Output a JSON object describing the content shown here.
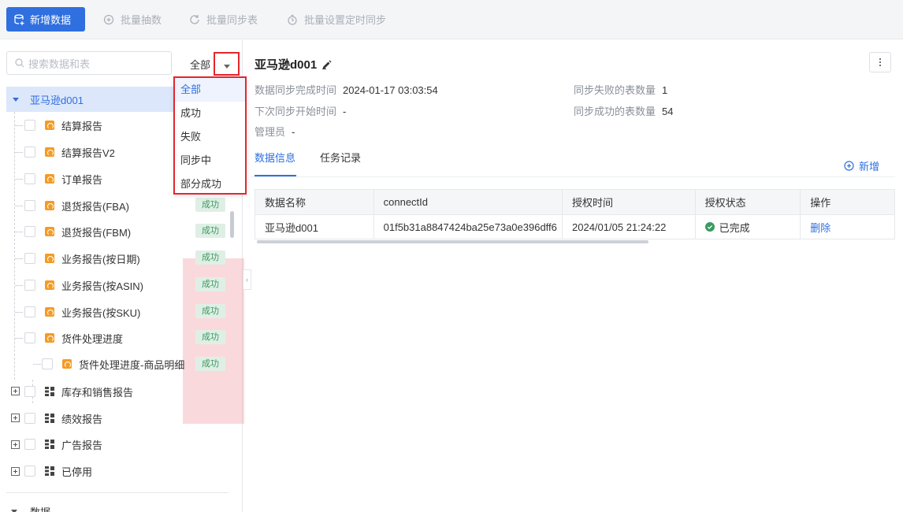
{
  "toolbar": {
    "add_data": "新增数据",
    "batch_extract": "批量抽数",
    "batch_sync": "批量同步表",
    "batch_schedule": "批量设置定时同步"
  },
  "sidebar": {
    "search_placeholder": "搜索数据和表",
    "filter_selected": "全部",
    "filter_options": [
      "全部",
      "成功",
      "失败",
      "同步中",
      "部分成功"
    ],
    "root": "亚马逊d001",
    "items": [
      {
        "label": "结算报告"
      },
      {
        "label": "结算报告V2"
      },
      {
        "label": "订单报告"
      },
      {
        "label": "退货报告(FBA)",
        "status": "成功"
      },
      {
        "label": "退货报告(FBM)",
        "status": "成功"
      },
      {
        "label": "业务报告(按日期)",
        "status": "成功"
      },
      {
        "label": "业务报告(按ASIN)",
        "status": "成功"
      },
      {
        "label": "业务报告(按SKU)",
        "status": "成功"
      },
      {
        "label": "货件处理进度",
        "status": "成功"
      },
      {
        "label": "货件处理进度-商品明细",
        "status": "成功"
      }
    ],
    "groups": [
      "库存和销售报告",
      "绩效报告",
      "广告报告",
      "已停用"
    ],
    "bottom_item": "数据"
  },
  "detail": {
    "title": "亚马逊d001",
    "sync_complete_label": "数据同步完成时间",
    "sync_complete_value": "2024-01-17 03:03:54",
    "next_sync_label": "下次同步开始时间",
    "next_sync_value": "-",
    "admin_label": "管理员",
    "admin_value": "-",
    "failed_tables_label": "同步失败的表数量",
    "failed_tables_value": "1",
    "success_tables_label": "同步成功的表数量",
    "success_tables_value": "54",
    "tabs": [
      "数据信息",
      "任务记录"
    ],
    "add_label": "新增"
  },
  "table": {
    "headers": [
      "数据名称",
      "connectId",
      "授权时间",
      "授权状态",
      "操作"
    ],
    "rows": [
      {
        "name": "亚马逊d001",
        "connect_id": "01f5b31a8847424ba25e73a0e396dff6",
        "auth_time": "2024/01/05 21:24:22",
        "status": "已完成",
        "action": "删除"
      }
    ]
  },
  "colors": {
    "primary": "#2f6fe0",
    "success": "#3a9a60",
    "highlight": "#e5262d"
  }
}
